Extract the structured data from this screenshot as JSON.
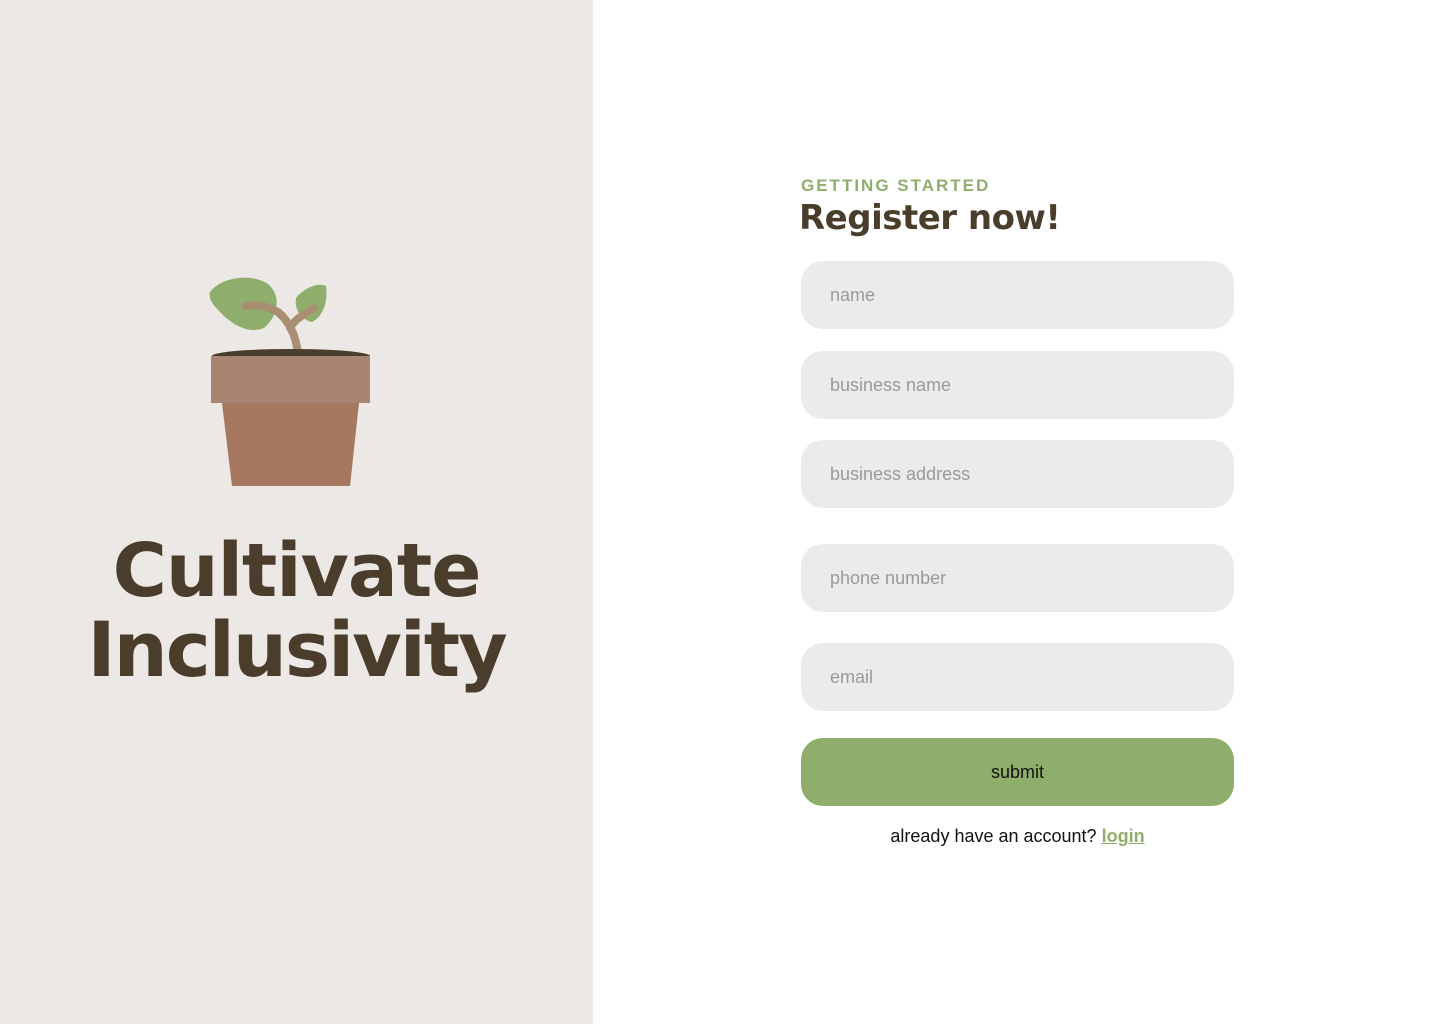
{
  "brand": {
    "line1": "Cultivate",
    "line2": "Inclusivity",
    "logo_icon": "potted-plant-icon"
  },
  "form": {
    "eyebrow": "GETTING STARTED",
    "heading": "Register now!",
    "fields": {
      "name": {
        "placeholder": "name",
        "value": ""
      },
      "business_name": {
        "placeholder": "business name",
        "value": ""
      },
      "business_address": {
        "placeholder": "business address",
        "value": ""
      },
      "phone_number": {
        "placeholder": "phone number",
        "value": ""
      },
      "email": {
        "placeholder": "email",
        "value": ""
      }
    },
    "submit_label": "submit",
    "login_prompt": "already have an account?",
    "login_link": "login"
  },
  "colors": {
    "left_panel_bg": "#ECE8E5",
    "accent_green": "#8FAE6B",
    "dark_brown": "#4A3D2B",
    "pot_rim": "#A88472",
    "pot_body": "#A6785F",
    "field_bg": "#EBEBEB"
  }
}
